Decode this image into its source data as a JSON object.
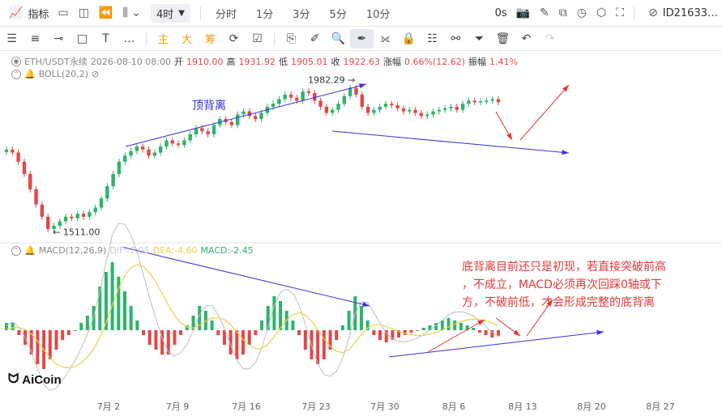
{
  "toolbar1": {
    "indicator_label": "指标",
    "period_selected": "4时",
    "periods": [
      "分时",
      "1分",
      "3分",
      "5分",
      "10分"
    ],
    "countdown": "0s",
    "account_id": "ID21633…"
  },
  "toolbar2": {
    "tags": [
      "主",
      "大",
      "筹"
    ]
  },
  "legend": {
    "symbol": "ETH/USDT永续",
    "datetime": "2026-08-10 08:00",
    "open_label": "开",
    "open": "1910.00",
    "high_label": "高",
    "high": "1931.92",
    "low_label": "低",
    "low": "1905.01",
    "close_label": "收",
    "close": "1922.63",
    "change_label": "涨幅",
    "change": "0.66%(12.62)",
    "amp_label": "振幅",
    "amp": "1.41%",
    "boll": "BOLL(20,2)",
    "macd": "MACD(12,26,9)",
    "dif": "DIF:-7.05",
    "dea": "DEA:-4.60",
    "macd_val": "MACD:-2.45"
  },
  "chart_data": {
    "type": "candlestick+macd",
    "symbol": "ETH/USDT永续",
    "interval": "4时",
    "x_ticks": [
      "7月 2",
      "7月 9",
      "7月 16",
      "7月 23",
      "7月 30",
      "8月 6",
      "8月 13",
      "8月 20",
      "8月 27"
    ],
    "price_low_marker": "1511.00",
    "price_high_marker": "1982.29",
    "price_range": [
      1480,
      2010
    ],
    "closes": [
      1780,
      1770,
      1740,
      1700,
      1650,
      1600,
      1560,
      1520,
      1530,
      1545,
      1560,
      1555,
      1570,
      1560,
      1575,
      1590,
      1620,
      1660,
      1700,
      1740,
      1760,
      1775,
      1790,
      1780,
      1760,
      1770,
      1790,
      1810,
      1800,
      1795,
      1810,
      1830,
      1850,
      1840,
      1830,
      1860,
      1880,
      1870,
      1860,
      1895,
      1905,
      1890,
      1880,
      1900,
      1920,
      1930,
      1945,
      1960,
      1950,
      1940,
      1970,
      1965,
      1940,
      1920,
      1900,
      1910,
      1930,
      1955,
      1982,
      1960,
      1920,
      1900,
      1910,
      1920,
      1930,
      1925,
      1915,
      1905,
      1910,
      1900,
      1890,
      1895,
      1905,
      1910,
      1915,
      1920,
      1910,
      1930,
      1940,
      1935,
      1938,
      1940,
      1945,
      1935
    ],
    "macd_hist": [
      3,
      3,
      -2,
      -6,
      -10,
      -14,
      -16,
      -12,
      -8,
      -4,
      -2,
      0,
      3,
      6,
      10,
      18,
      24,
      28,
      22,
      16,
      10,
      4,
      -2,
      -6,
      -8,
      -10,
      -10,
      -6,
      -2,
      2,
      6,
      10,
      8,
      4,
      -2,
      -6,
      -10,
      -12,
      -10,
      -6,
      -2,
      4,
      10,
      14,
      12,
      8,
      4,
      -2,
      -8,
      -12,
      -14,
      -12,
      -8,
      -4,
      2,
      8,
      14,
      10,
      4,
      -2,
      -4,
      -5,
      -4,
      -3,
      -2,
      -1,
      0,
      1,
      2,
      3,
      4,
      5,
      4,
      3,
      2,
      1,
      -1,
      -2,
      -3,
      -2.45
    ],
    "annotations": {
      "top_divergence": "顶背离",
      "bottom_note": [
        "底背离目前还只是初现，若直接突破前高",
        "，不成立，MACD必须再次回踩0轴或下",
        "方，不破前低，才会形成完整的底背离"
      ]
    }
  },
  "logo_text": "AiCoin"
}
